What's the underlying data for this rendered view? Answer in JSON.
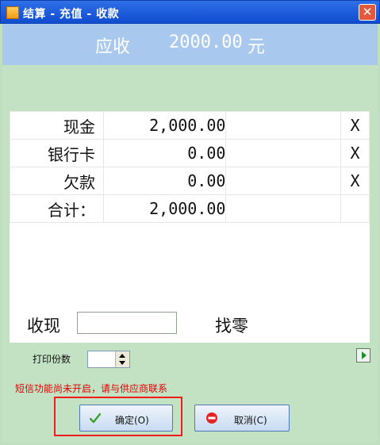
{
  "window": {
    "title": "结算 - 充值 - 收款",
    "close_glyph": "✕"
  },
  "header": {
    "label": "应收",
    "amount": "2000.00",
    "unit": "元"
  },
  "payments": {
    "rows": [
      {
        "name": "现金",
        "amount": "2,000.00",
        "remove": "X"
      },
      {
        "name": "银行卡",
        "amount": "0.00",
        "remove": "X"
      },
      {
        "name": "欠款",
        "amount": "0.00",
        "remove": "X"
      }
    ],
    "total": {
      "name": "合计：",
      "amount": "2,000.00"
    }
  },
  "received": {
    "label": "收现",
    "value": ""
  },
  "change": {
    "label": "找零"
  },
  "print": {
    "label": "打印份数",
    "value": ""
  },
  "sms_message": "短信功能尚未开启，请与供应商联系",
  "buttons": {
    "ok_label": "确定(O)",
    "cancel_label": "取消(C)"
  }
}
